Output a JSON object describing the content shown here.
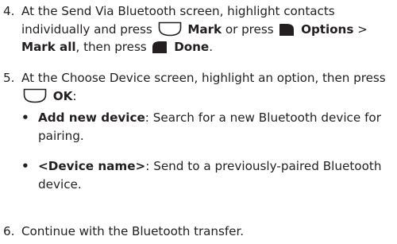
{
  "step4": {
    "number": "4.",
    "text_a": "At the Send Via Bluetooth screen, highlight contacts individually and press",
    "mark_label": "Mark",
    "text_b": "or press",
    "options_label": "Options",
    "sep": ">",
    "mark_all_label": "Mark all",
    "text_c": ", then press",
    "done_label": "Done",
    "end": "."
  },
  "step5": {
    "number": "5.",
    "text_a": "At the Choose Device screen, highlight an option, then press",
    "ok_label": "OK",
    "end": ":"
  },
  "bullets": [
    {
      "dot": "•",
      "term": "Add new device",
      "desc": ": Search for a new Bluetooth device for pairing."
    },
    {
      "dot": "•",
      "term": "<Device name>",
      "desc": ": Send to a previously-paired Bluetooth device."
    }
  ],
  "step6": {
    "number": "6.",
    "text": "Continue with the Bluetooth transfer."
  },
  "icons": {
    "center_key": "center-select-key-icon",
    "left_softkey": "left-softkey-icon",
    "right_softkey": "right-softkey-icon",
    "icon_fill": "#ffffff",
    "icon_stroke": "#231f20",
    "softkey_fill": "#231f20"
  }
}
